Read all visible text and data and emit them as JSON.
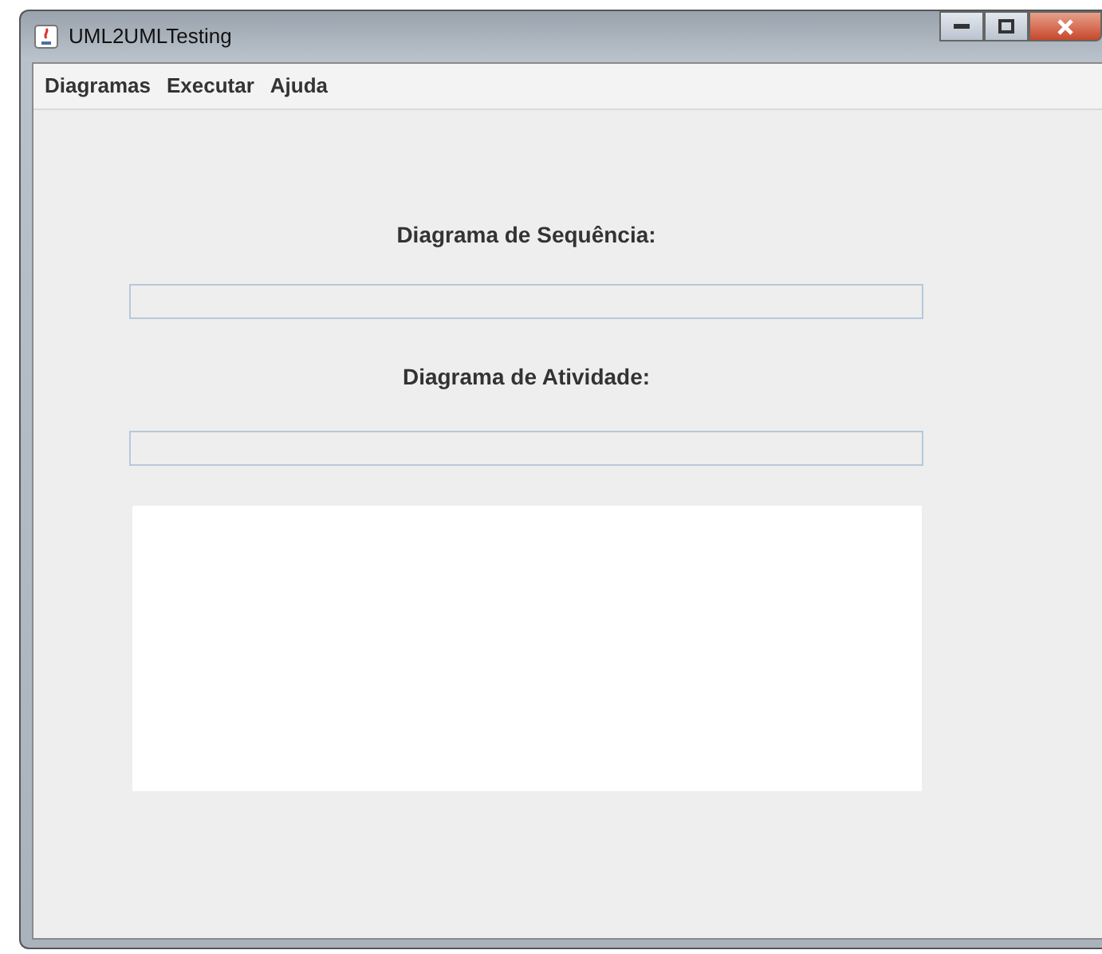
{
  "window": {
    "title": "UML2UMLTesting"
  },
  "menu": [
    "Diagramas",
    "Executar",
    "Ajuda"
  ],
  "form": {
    "sequence_label": "Diagrama de Sequência:",
    "activity_label": "Diagrama de Atividade:"
  }
}
